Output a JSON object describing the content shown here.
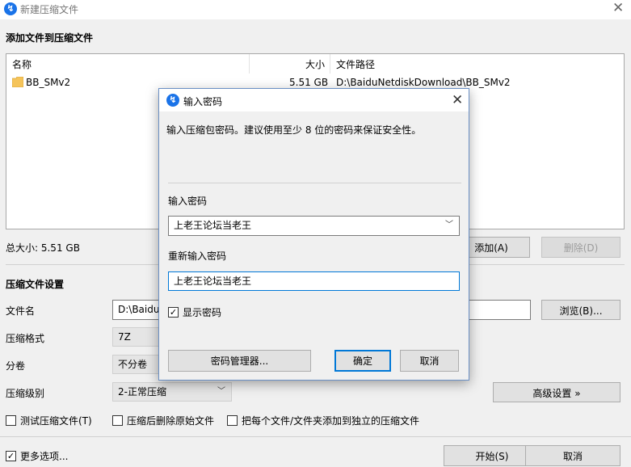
{
  "window": {
    "title": "新建压缩文件",
    "close_glyph": "✕"
  },
  "add_files": {
    "section_title": "添加文件到压缩文件",
    "columns": {
      "name": "名称",
      "size": "大小",
      "path": "文件路径"
    },
    "rows": [
      {
        "name": "BB_SMv2",
        "size": "5.51 GB",
        "path": "D:\\BaiduNetdiskDownload\\BB_SMv2"
      }
    ],
    "total": "总大小: 5.51 GB",
    "add_button": "添加(A)",
    "remove_button": "删除(D)"
  },
  "settings": {
    "section_title": "压缩文件设置",
    "filename_label": "文件名",
    "filename_value": "D:\\BaiduN",
    "browse_button": "浏览(B)...",
    "format_label": "压缩格式",
    "format_value": "7Z",
    "split_label": "分卷",
    "split_value": "不分卷",
    "level_label": "压缩级别",
    "level_value": "2-正常压缩",
    "advanced_button": "高级设置 »",
    "test_checkbox": "测试压缩文件(T)",
    "delete_checkbox": "压缩后删除原始文件",
    "separate_checkbox": "把每个文件/文件夹添加到独立的压缩文件"
  },
  "footer": {
    "more_options": "更多选项...",
    "start_button": "开始(S)",
    "cancel_button": "取消"
  },
  "dialog": {
    "title": "输入密码",
    "close_glyph": "✕",
    "hint": "输入压缩包密码。建议使用至少 8 位的密码来保证安全性。",
    "password_label": "输入密码",
    "password_value": "上老王论坛当老王",
    "confirm_label": "重新输入密码",
    "confirm_value": "上老王论坛当老王",
    "show_password": "显示密码",
    "manager_button": "密码管理器...",
    "ok_button": "确定",
    "cancel_button": "取消"
  },
  "icons": {
    "app": "app-logo-icon",
    "folder": "folder-icon",
    "dropdown": "chevron-down-icon",
    "check": "checkmark-icon"
  },
  "colors": {
    "accent": "#0078d7",
    "app_logo": "#1a73e8",
    "folder": "#f5c45a"
  }
}
